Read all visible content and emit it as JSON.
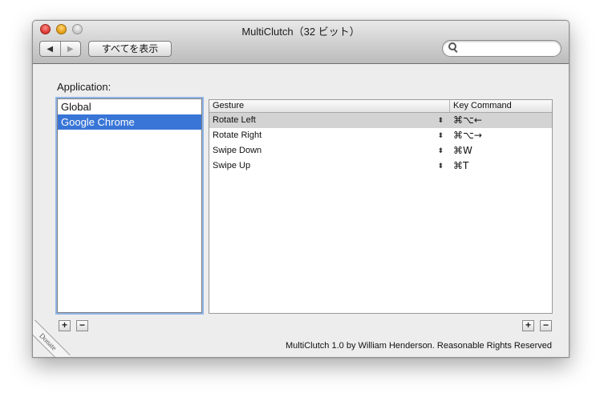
{
  "window": {
    "title": "MultiClutch（32 ビット）"
  },
  "toolbar": {
    "back_symbol": "◀",
    "forward_symbol": "▶",
    "show_all_label": "すべてを表示",
    "search": {
      "placeholder": "",
      "value": "",
      "icon": "magnifier-icon"
    }
  },
  "applications": {
    "label": "Application:",
    "items": [
      {
        "name": "Global",
        "selected": false
      },
      {
        "name": "Google Chrome",
        "selected": true
      }
    ]
  },
  "gestures_table": {
    "columns": [
      "Gesture",
      "Key Command"
    ],
    "rows": [
      {
        "gesture": "Rotate Left",
        "key": "⌘⌥←",
        "selected": true
      },
      {
        "gesture": "Rotate Right",
        "key": "⌘⌥→",
        "selected": false
      },
      {
        "gesture": "Swipe Down",
        "key": "⌘W",
        "selected": false
      },
      {
        "gesture": "Swipe Up",
        "key": "⌘T",
        "selected": false
      }
    ],
    "stepper_symbol": "⬍"
  },
  "buttons": {
    "add": "+",
    "remove": "−"
  },
  "footer": {
    "credits": "MultiClutch 1.0 by William Henderson.  Reasonable Rights Reserved",
    "donate": "Donate"
  },
  "colors": {
    "selection": "#3875d7",
    "row_selection": "#d3d3d3",
    "focus_ring": "#8fb4e8"
  }
}
